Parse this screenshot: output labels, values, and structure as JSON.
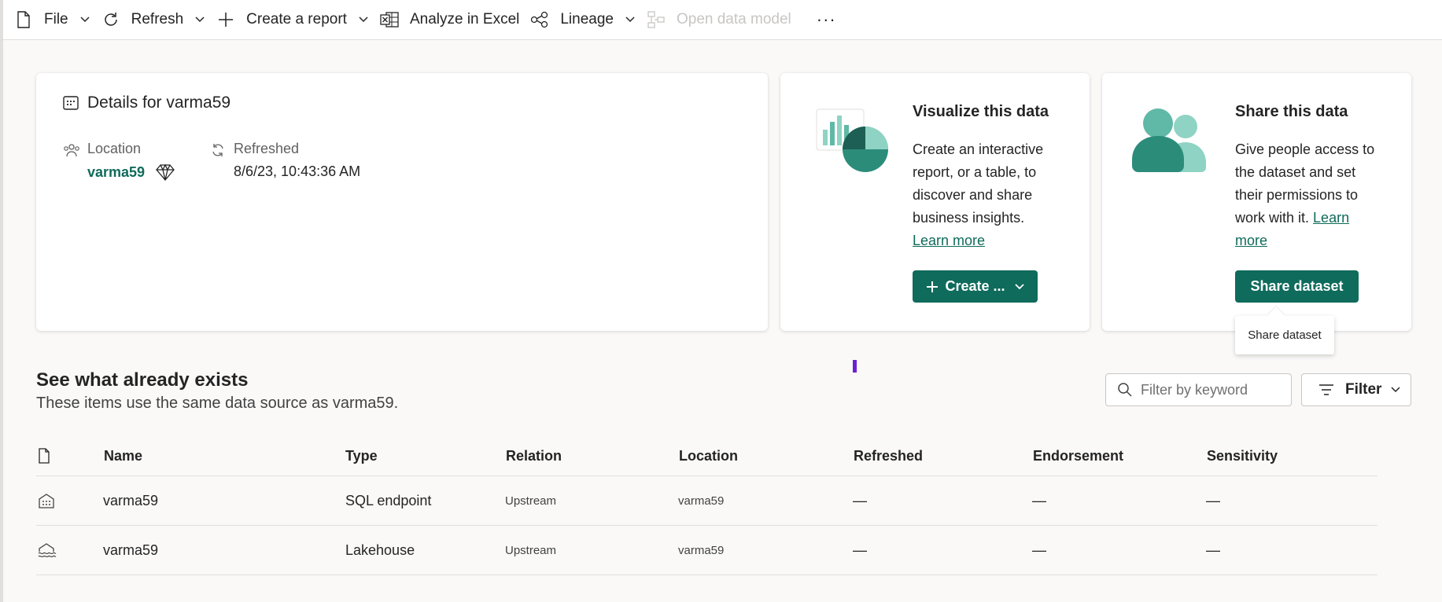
{
  "toolbar": {
    "file": "File",
    "refresh": "Refresh",
    "create_report": "Create a report",
    "analyze_excel": "Analyze in Excel",
    "lineage": "Lineage",
    "open_data_model": "Open data model",
    "more": "···"
  },
  "details": {
    "title": "Details for varma59",
    "location_label": "Location",
    "location_value": "varma59",
    "refreshed_label": "Refreshed",
    "refreshed_value": "8/6/23, 10:43:36 AM"
  },
  "visualize": {
    "title": "Visualize this data",
    "line1": "Create an interactive",
    "line2": "report, or a table, to",
    "line3": "discover and share",
    "line4": "business insights.",
    "learn_more": "Learn more",
    "button": "Create ..."
  },
  "share": {
    "title": "Share this data",
    "line1": "Give people access to",
    "line2": "the dataset and set",
    "line3": "their permissions to",
    "line4": "work with it.",
    "learn_more_a": "Learn",
    "learn_more_b": "more",
    "button": "Share dataset",
    "tooltip": "Share dataset"
  },
  "section": {
    "title": "See what already exists",
    "subtitle": "These items use the same data source as varma59.",
    "search_placeholder": "Filter by keyword",
    "filter": "Filter"
  },
  "table": {
    "headers": {
      "name": "Name",
      "type": "Type",
      "relation": "Relation",
      "location": "Location",
      "refreshed": "Refreshed",
      "endorsement": "Endorsement",
      "sensitivity": "Sensitivity"
    },
    "rows": [
      {
        "icon": "sql-endpoint-icon",
        "name": "varma59",
        "type": "SQL endpoint",
        "relation": "Upstream",
        "location": "varma59",
        "refreshed": "—",
        "endorsement": "—",
        "sensitivity": "—"
      },
      {
        "icon": "lakehouse-icon",
        "name": "varma59",
        "type": "Lakehouse",
        "relation": "Upstream",
        "location": "varma59",
        "refreshed": "—",
        "endorsement": "—",
        "sensitivity": "—"
      }
    ]
  },
  "colors": {
    "accent": "#0f6b5b",
    "tooltip_bg": "#ffffff",
    "cursor": "#6f1fd2"
  }
}
